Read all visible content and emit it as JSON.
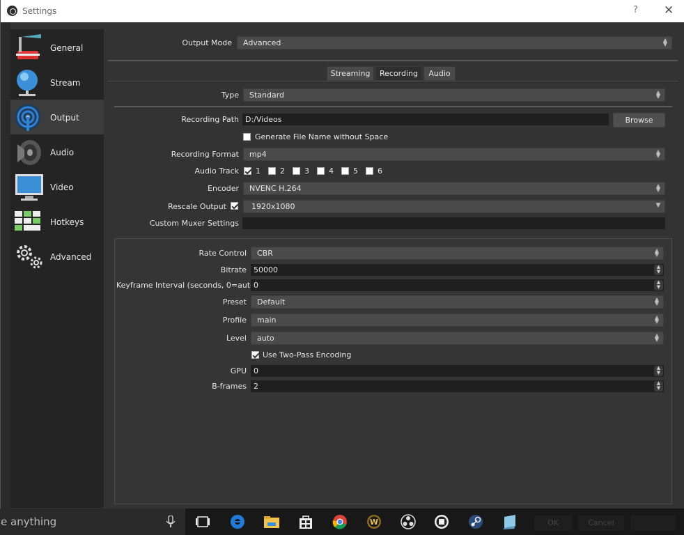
{
  "window": {
    "title": "Settings",
    "help": "?",
    "close": "✕"
  },
  "sidebar": {
    "items": [
      {
        "label": "General",
        "icon": "general-icon"
      },
      {
        "label": "Stream",
        "icon": "stream-icon"
      },
      {
        "label": "Output",
        "icon": "output-icon"
      },
      {
        "label": "Audio",
        "icon": "audio-icon"
      },
      {
        "label": "Video",
        "icon": "video-icon"
      },
      {
        "label": "Hotkeys",
        "icon": "hotkeys-icon"
      },
      {
        "label": "Advanced",
        "icon": "advanced-icon"
      }
    ],
    "active": "Output"
  },
  "output_mode": {
    "label": "Output Mode",
    "value": "Advanced"
  },
  "tabs": [
    {
      "label": "Streaming"
    },
    {
      "label": "Recording"
    },
    {
      "label": "Audio"
    }
  ],
  "recording": {
    "type_label": "Type",
    "type_value": "Standard",
    "path_label": "Recording Path",
    "path_value": "D:/Videos",
    "browse": "Browse",
    "gen_filename": "Generate File Name without Space",
    "format_label": "Recording Format",
    "format_value": "mp4",
    "audio_track_label": "Audio Track",
    "tracks": [
      "1",
      "2",
      "3",
      "4",
      "5",
      "6"
    ],
    "encoder_label": "Encoder",
    "encoder_value": "NVENC H.264",
    "rescale_label": "Rescale Output",
    "rescale_value": "1920x1080",
    "muxer_label": "Custom Muxer Settings",
    "muxer_value": ""
  },
  "encoder": {
    "rate_control_label": "Rate Control",
    "rate_control_value": "CBR",
    "bitrate_label": "Bitrate",
    "bitrate_value": "50000",
    "keyframe_label": "Keyframe Interval (seconds, 0=auto)",
    "keyframe_value": "0",
    "preset_label": "Preset",
    "preset_value": "Default",
    "profile_label": "Profile",
    "profile_value": "main",
    "level_label": "Level",
    "level_value": "auto",
    "two_pass": "Use Two-Pass Encoding",
    "gpu_label": "GPU",
    "gpu_value": "0",
    "bframes_label": "B-frames",
    "bframes_value": "2"
  },
  "dialog_buttons": {
    "ok": "OK",
    "cancel": "Cancel"
  },
  "taskbar": {
    "search_text": "e anything"
  },
  "colors": {
    "accent": "#3d3d3d",
    "panel": "#333333",
    "field": "#1f1f1f"
  }
}
